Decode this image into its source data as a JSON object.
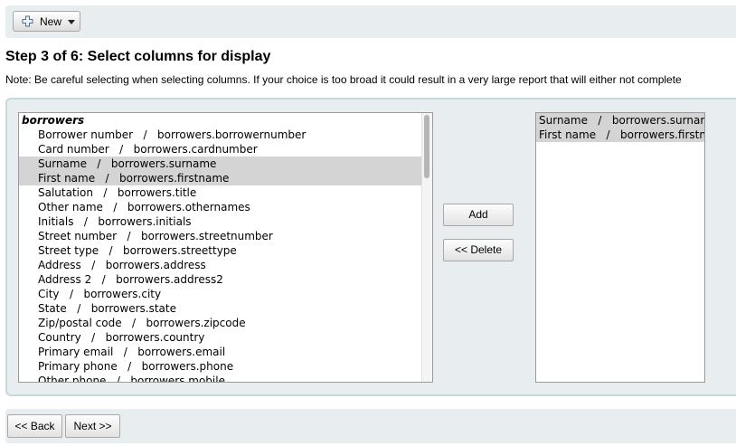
{
  "toolbar": {
    "new_label": "New",
    "icons": {
      "plus": "plus-icon",
      "caret": "caret-down-icon"
    }
  },
  "heading": "Step 3 of 6: Select columns for display",
  "note": "Note: Be careful selecting when selecting columns. If your choice is too broad it could result in a very large report that will either not complete",
  "available": {
    "group": "borrowers",
    "options": [
      {
        "label": "Borrower number   /   borrowers.borrowernumber",
        "selected": false
      },
      {
        "label": "Card number   /   borrowers.cardnumber",
        "selected": false
      },
      {
        "label": "Surname   /   borrowers.surname",
        "selected": true
      },
      {
        "label": "First name   /   borrowers.firstname",
        "selected": true
      },
      {
        "label": "Salutation   /   borrowers.title",
        "selected": false
      },
      {
        "label": "Other name   /   borrowers.othernames",
        "selected": false
      },
      {
        "label": "Initials   /   borrowers.initials",
        "selected": false
      },
      {
        "label": "Street number   /   borrowers.streetnumber",
        "selected": false
      },
      {
        "label": "Street type   /   borrowers.streettype",
        "selected": false
      },
      {
        "label": "Address   /   borrowers.address",
        "selected": false
      },
      {
        "label": "Address 2   /   borrowers.address2",
        "selected": false
      },
      {
        "label": "City   /   borrowers.city",
        "selected": false
      },
      {
        "label": "State   /   borrowers.state",
        "selected": false
      },
      {
        "label": "Zip/postal code   /   borrowers.zipcode",
        "selected": false
      },
      {
        "label": "Country   /   borrowers.country",
        "selected": false
      },
      {
        "label": "Primary email   /   borrowers.email",
        "selected": false
      },
      {
        "label": "Primary phone   /   borrowers.phone",
        "selected": false
      },
      {
        "label": "Other phone   /   borrowers.mobile",
        "selected": false
      }
    ]
  },
  "chosen": {
    "options": [
      {
        "label": "Surname   /   borrowers.surname"
      },
      {
        "label": "First name   /   borrowers.firstname"
      }
    ]
  },
  "buttons": {
    "add": "Add",
    "delete": "<< Delete",
    "back": "<< Back",
    "next": "Next >>"
  }
}
